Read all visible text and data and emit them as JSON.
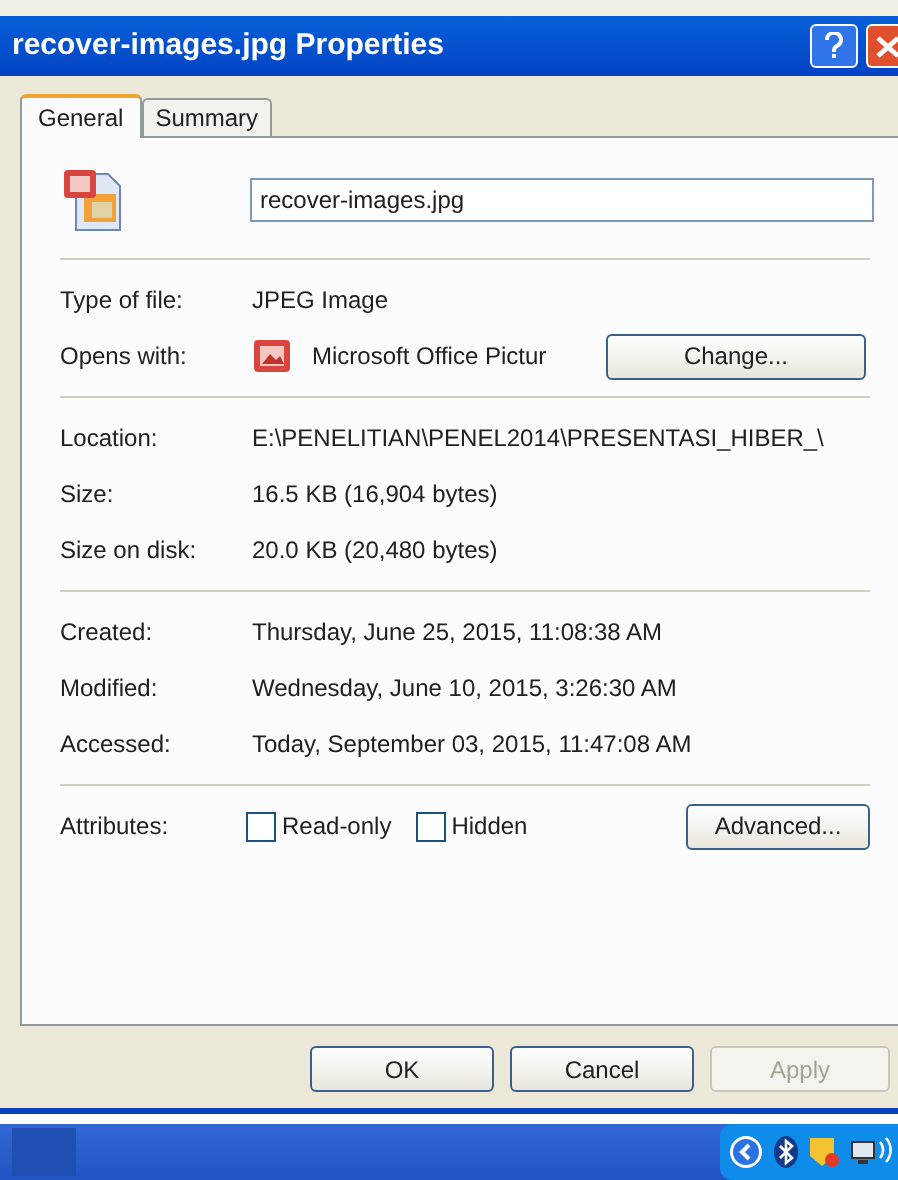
{
  "window": {
    "title": "recover-images.jpg Properties"
  },
  "tabs": [
    {
      "label": "General",
      "selected": true
    },
    {
      "label": "Summary",
      "selected": false
    }
  ],
  "file_name": {
    "value": "recover-images.jpg"
  },
  "type_section": [
    {
      "label": "Type of file:",
      "value": "JPEG Image"
    },
    {
      "label": "Opens with:",
      "value": "Microsoft Office Pictur",
      "button": "Change..."
    }
  ],
  "location_section": [
    {
      "label": "Location:",
      "value": "E:\\PENELITIAN\\PENEL2014\\PRESENTASI_HIBER_\\"
    },
    {
      "label": "Size:",
      "value": "16.5 KB (16,904 bytes)"
    },
    {
      "label": "Size on disk:",
      "value": "20.0 KB (20,480 bytes)"
    }
  ],
  "dates_section": [
    {
      "label": "Created:",
      "value": "Thursday, June 25, 2015, 11:08:38 AM"
    },
    {
      "label": "Modified:",
      "value": "Wednesday, June 10, 2015, 3:26:30 AM"
    },
    {
      "label": "Accessed:",
      "value": "Today, September 03, 2015, 11:47:08 AM"
    }
  ],
  "attributes": {
    "label": "Attributes:",
    "options": [
      {
        "label": "Read-only",
        "checked": false
      },
      {
        "label": "Hidden",
        "checked": false
      }
    ],
    "button": "Advanced..."
  },
  "buttons": [
    {
      "label": "OK",
      "disabled": false
    },
    {
      "label": "Cancel",
      "disabled": false
    },
    {
      "label": "Apply",
      "disabled": true
    }
  ]
}
